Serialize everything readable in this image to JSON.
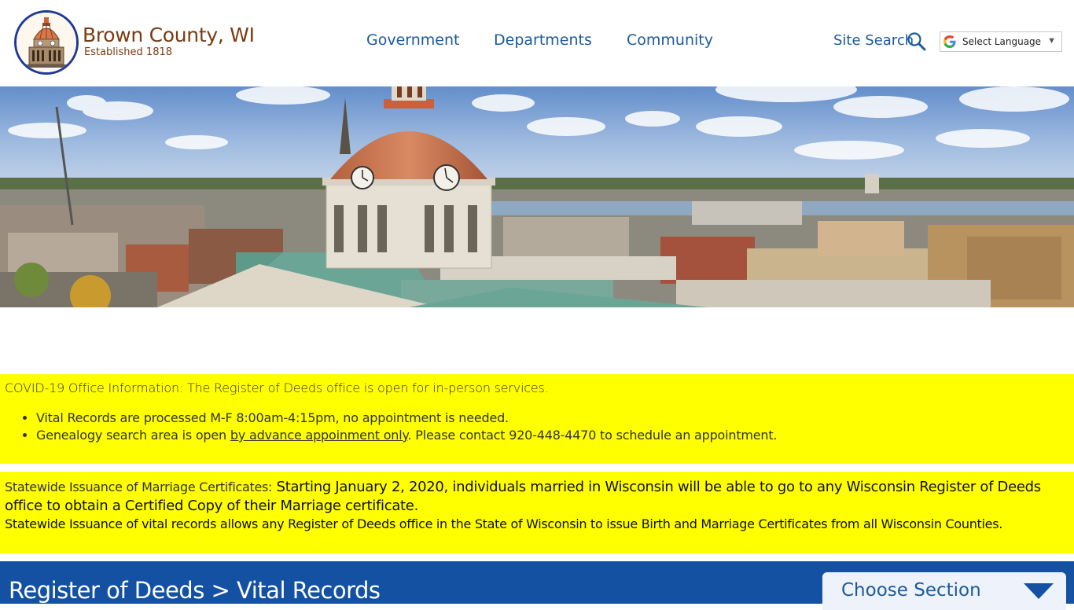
{
  "header": {
    "site_name": "Brown County, WI",
    "established": "Established 1818",
    "nav": [
      {
        "label": "Government"
      },
      {
        "label": "Departments"
      },
      {
        "label": "Community"
      }
    ],
    "site_search_label": "Site Search",
    "search_icon": "search-icon",
    "language_label": "Select Language",
    "language_caret": "▼"
  },
  "notices": {
    "covid": {
      "heading": "COVID-19 Office Information: The Register of Deeds office is open for in-person services.",
      "item1": "Vital Records are processed M-F 8:00am-4:15pm, no appointment is needed.",
      "item2_before": "Genealogy search area is open ",
      "item2_link": "by advance appoinment only",
      "item2_after": ". Please contact 920-448-4470 to schedule an appointment."
    },
    "statewide": {
      "label": "Statewide Issuance of Marriage Certificates:",
      "text": " Starting January 2, 2020, individuals married in Wisconsin will be able to go to any Wisconsin Register of Deeds office to obtain a Certified Copy of their Marriage certificate.",
      "line2": "Statewide Issuance of vital records allows any Register of Deeds office in the State of Wisconsin to issue Birth and Marriage Certificates from all Wisconsin Counties."
    }
  },
  "title_bar": {
    "page_title": "Register of Deeds > Vital Records",
    "choose_section": "Choose Section"
  },
  "colors": {
    "nav_blue": "#1d5a9b",
    "brand_brown": "#7a3b12",
    "notice_yellow": "#ffff00",
    "title_bar_blue": "#1451a3"
  }
}
